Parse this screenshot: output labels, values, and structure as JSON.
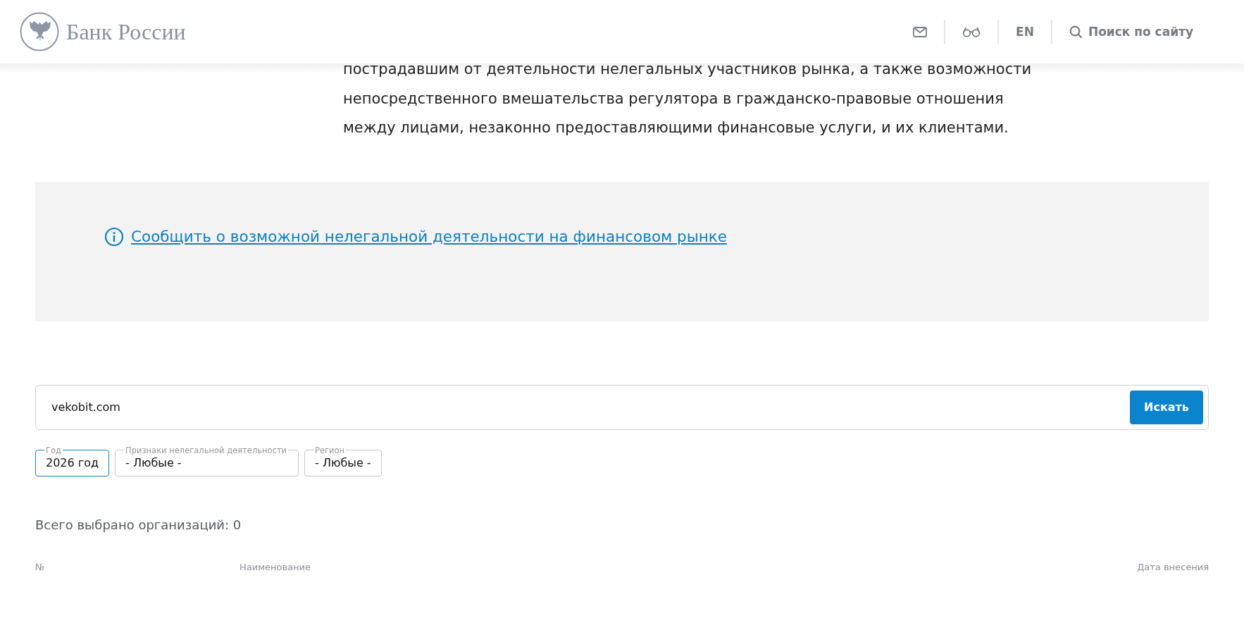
{
  "header": {
    "logo_text": "Банк России",
    "language": "EN",
    "search_label": "Поиск по сайту"
  },
  "intro": {
    "lines": [
      "пострадавшим от деятельности нелегальных участников рынка, а также возможности",
      "непосредственного вмешательства регулятора в гражданско-правовые отношения",
      "между лицами, незаконно предоставляющими финансовые услуги, и их клиентами."
    ]
  },
  "notice": {
    "link": "Сообщить о возможной нелегальной деятельности на финансовом рынке"
  },
  "search": {
    "value": "vekobit.com",
    "button": "Искать"
  },
  "filters": [
    {
      "label": "Год",
      "value": "2026 год",
      "selected": true
    },
    {
      "label": "Признаки нелегальной деятельности",
      "value": "- Любые -",
      "selected": false
    },
    {
      "label": "Регион",
      "value": "- Любые -",
      "selected": false
    }
  ],
  "total": "Всего выбрано организаций: 0",
  "table": {
    "columns": [
      "№",
      "Наименование",
      "Дата внесения"
    ]
  }
}
